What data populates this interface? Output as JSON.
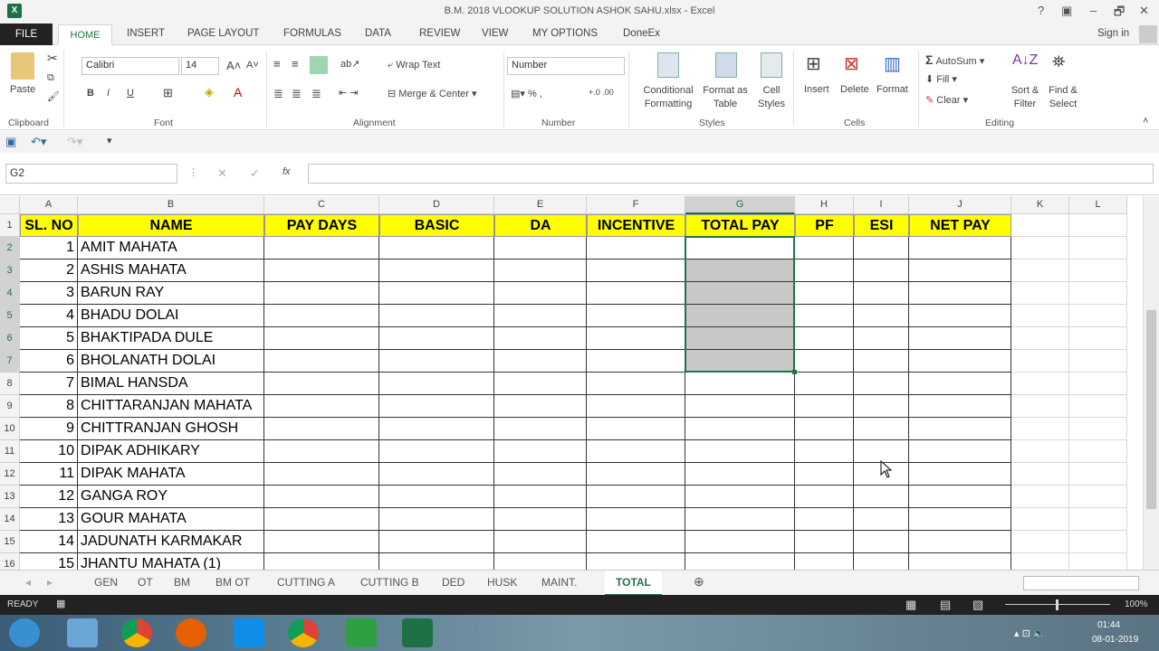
{
  "window": {
    "title": "B.M. 2018 VLOOKUP SOLUTION ASHOK SAHU.xlsx - Excel",
    "help": "?",
    "minimize": "–",
    "restore": "🗗",
    "close": "✕",
    "signin": "Sign in"
  },
  "tabs": [
    "FILE",
    "HOME",
    "INSERT",
    "PAGE LAYOUT",
    "FORMULAS",
    "DATA",
    "REVIEW",
    "VIEW",
    "MY OPTIONS",
    "DoneEx"
  ],
  "ribbon": {
    "paste": "Paste",
    "clipboard": "Clipboard",
    "font_name": "Calibri",
    "font_size": "14",
    "font": "Font",
    "wrap_text": "Wrap Text",
    "merge_center": "Merge & Center",
    "alignment": "Alignment",
    "number_format": "Number",
    "number": "Number",
    "cond_fmt": "Conditional Formatting",
    "fmt_table": "Format as Table",
    "cell_styles": "Cell Styles",
    "styles": "Styles",
    "insert": "Insert",
    "delete": "Delete",
    "format": "Format",
    "cells": "Cells",
    "autosum": "AutoSum",
    "fill": "Fill",
    "clear": "Clear",
    "sort_filter": "Sort & Filter",
    "find_select": "Find & Select",
    "editing": "Editing",
    "bold": "B",
    "italic": "I",
    "underline": "U"
  },
  "formula_bar": {
    "name_box": "G2",
    "fx": "fx",
    "value": ""
  },
  "columns": [
    "A",
    "B",
    "C",
    "D",
    "E",
    "F",
    "G",
    "H",
    "I",
    "J",
    "K",
    "L"
  ],
  "headers": [
    "SL. NO",
    "NAME",
    "PAY DAYS",
    "BASIC",
    "DA",
    "INCENTIVE",
    "TOTAL PAY",
    "PF",
    "ESI",
    "NET PAY"
  ],
  "rows": [
    [
      "1",
      "AMIT MAHATA"
    ],
    [
      "2",
      "ASHIS MAHATA"
    ],
    [
      "3",
      "BARUN RAY"
    ],
    [
      "4",
      "BHADU DOLAI"
    ],
    [
      "5",
      "BHAKTIPADA DULE"
    ],
    [
      "6",
      "BHOLANATH DOLAI"
    ],
    [
      "7",
      "BIMAL HANSDA"
    ],
    [
      "8",
      "CHITTARANJAN MAHATA"
    ],
    [
      "9",
      "CHITTRANJAN GHOSH"
    ],
    [
      "10",
      "DIPAK ADHIKARY"
    ],
    [
      "11",
      "DIPAK MAHATA"
    ],
    [
      "12",
      "GANGA ROY"
    ],
    [
      "13",
      "GOUR MAHATA"
    ],
    [
      "14",
      "JADUNATH KARMAKAR"
    ],
    [
      "15",
      "JHANTU MAHATA (1)"
    ]
  ],
  "sheets": [
    "GEN",
    "OT",
    "BM",
    "BM OT",
    "CUTTING A",
    "CUTTING B",
    "DED",
    "HUSK",
    "MAINT.",
    "TOTAL"
  ],
  "active_sheet": "TOTAL",
  "status": {
    "ready": "READY",
    "zoom": "100%"
  },
  "taskbar": {
    "time": "01:44",
    "date": "08-01-2019"
  },
  "colors": {
    "accent": "#217346",
    "header_fill": "#ffff00",
    "selection": "#c8c8c8"
  }
}
